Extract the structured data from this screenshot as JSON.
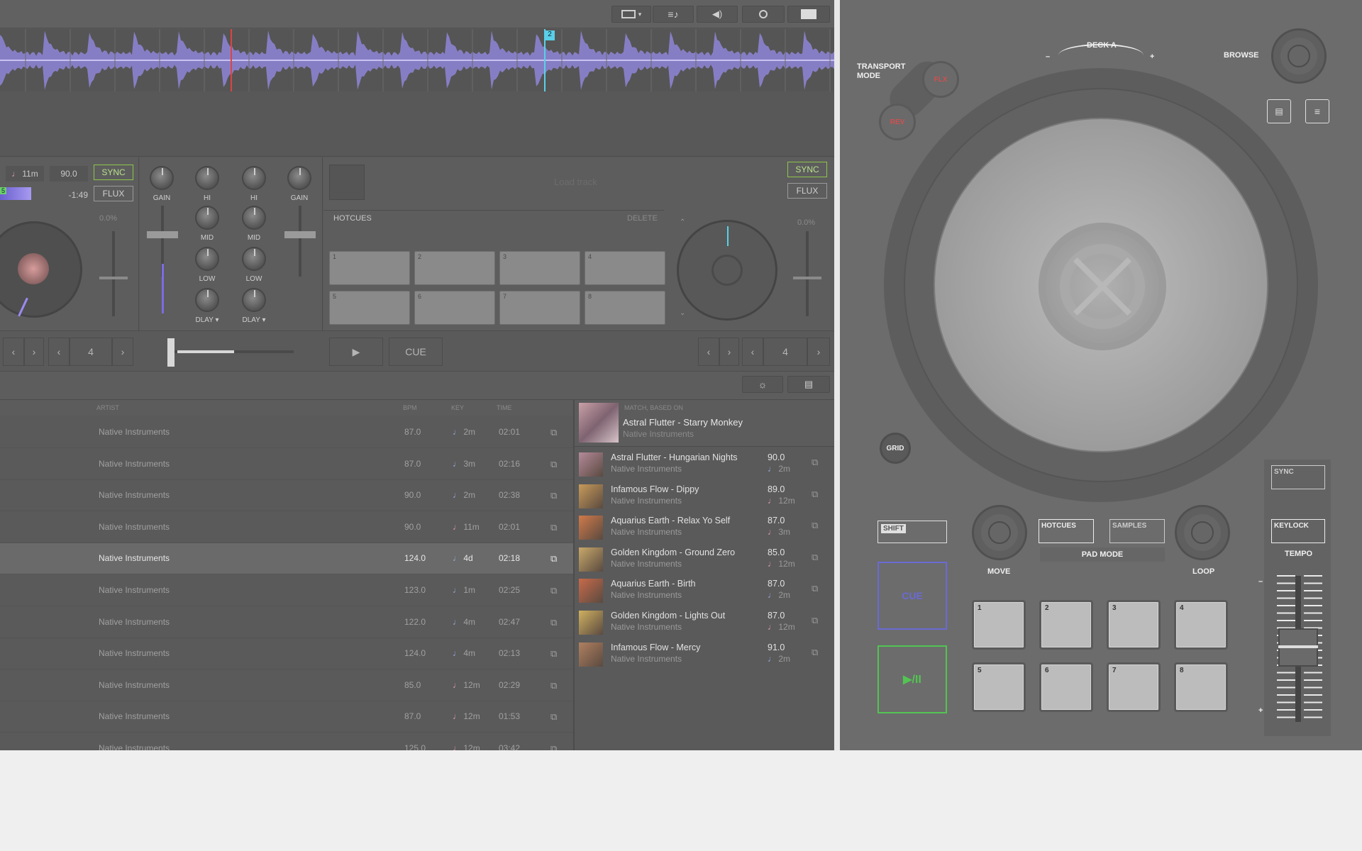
{
  "software": {
    "toolbar": {
      "layout_icon": "layout-icon",
      "list_icon": "playlist-icon",
      "volume_icon": "volume-icon",
      "record_icon": "record-icon",
      "ni_icon": "ni-logo-icon"
    },
    "waveform": {
      "cue_marker": "2"
    },
    "deck_left": {
      "key": "11m",
      "bpm": "90.0",
      "sync": "SYNC",
      "flux": "FLUX",
      "time": "-1:49",
      "pitch": "0.0%",
      "loop_size": "4",
      "cue_num": "5"
    },
    "mixer": {
      "gain_left": "GAIN",
      "hi_left": "HI",
      "mid_left": "MID",
      "low_left": "LOW",
      "fx_left": "DLAY",
      "hi_right": "HI",
      "mid_right": "MID",
      "low_right": "LOW",
      "fx_right": "DLAY",
      "gain_right": "GAIN"
    },
    "deck_right": {
      "load": "Load track",
      "sync": "SYNC",
      "flux": "FLUX",
      "pitch": "0.0%",
      "loop_size": "4",
      "hotcues_title": "HOTCUES",
      "delete": "DELETE",
      "pads": [
        "1",
        "2",
        "3",
        "4",
        "5",
        "6",
        "7",
        "8"
      ],
      "play": "▶",
      "cue": "CUE"
    },
    "browser": {
      "headers": {
        "artist": "ARTIST",
        "bpm": "BPM",
        "key": "KEY",
        "time": "TIME"
      },
      "rows": [
        {
          "artist": "Native Instruments",
          "bpm": "87.0",
          "key": "2m",
          "time": "02:01",
          "kc": "#9aaee6"
        },
        {
          "artist": "Native Instruments",
          "bpm": "87.0",
          "key": "3m",
          "time": "02:16",
          "kc": "#9aaee6"
        },
        {
          "artist": "Native Instruments",
          "bpm": "90.0",
          "key": "2m",
          "time": "02:38",
          "kc": "#9aaee6"
        },
        {
          "artist": "Native Instruments",
          "bpm": "90.0",
          "key": "11m",
          "time": "02:01",
          "kc": "#e6a0b4"
        },
        {
          "artist": "Native Instruments",
          "bpm": "124.0",
          "key": "4d",
          "time": "02:18",
          "kc": "#9aaee6",
          "selected": true
        },
        {
          "artist": "Native Instruments",
          "bpm": "123.0",
          "key": "1m",
          "time": "02:25",
          "kc": "#9aaee6"
        },
        {
          "artist": "Native Instruments",
          "bpm": "122.0",
          "key": "4m",
          "time": "02:47",
          "kc": "#9aaee6"
        },
        {
          "artist": "Native Instruments",
          "bpm": "124.0",
          "key": "4m",
          "time": "02:13",
          "kc": "#9aaee6"
        },
        {
          "artist": "Native Instruments",
          "bpm": "85.0",
          "key": "12m",
          "time": "02:29",
          "kc": "#e6a0b4"
        },
        {
          "artist": "Native Instruments",
          "bpm": "87.0",
          "key": "12m",
          "time": "01:53",
          "kc": "#e6a0b4"
        },
        {
          "artist": "Native Instruments",
          "bpm": "125.0",
          "key": "12m",
          "time": "03:42",
          "kc": "#e6a0b4"
        }
      ],
      "match": {
        "label": "MATCH, BASED ON",
        "base_title": "Astral Flutter - Starry Monkey",
        "base_artist": "Native Instruments",
        "items": [
          {
            "title": "Astral Flutter - Hungarian Nights",
            "artist": "Native Instruments",
            "bpm": "90.0",
            "key": "2m",
            "kc": "#9aaee6"
          },
          {
            "title": "Infamous Flow - Dippy",
            "artist": "Native Instruments",
            "bpm": "89.0",
            "key": "12m",
            "kc": "#e6a0b4"
          },
          {
            "title": "Aquarius Earth - Relax Yo Self",
            "artist": "Native Instruments",
            "bpm": "87.0",
            "key": "3m",
            "kc": "#e6a0b4"
          },
          {
            "title": "Golden Kingdom - Ground Zero",
            "artist": "Native Instruments",
            "bpm": "85.0",
            "key": "12m",
            "kc": "#e6a0b4"
          },
          {
            "title": "Aquarius Earth - Birth",
            "artist": "Native Instruments",
            "bpm": "87.0",
            "key": "2m",
            "kc": "#9aaee6"
          },
          {
            "title": "Golden Kingdom - Lights Out",
            "artist": "Native Instruments",
            "bpm": "87.0",
            "key": "12m",
            "kc": "#e6a0b4"
          },
          {
            "title": "Infamous Flow - Mercy",
            "artist": "Native Instruments",
            "bpm": "91.0",
            "key": "2m",
            "kc": "#9aaee6"
          }
        ]
      }
    }
  },
  "hardware": {
    "transport_mode": "TRANSPORT\nMODE",
    "flx": "FLX",
    "rev": "REV",
    "deck": "DECK A",
    "minus": "–",
    "plus": "+",
    "browse": "BROWSE",
    "grid": "GRID",
    "shift": "SHIFT",
    "cue": "CUE",
    "playpause": "▶/II",
    "move": "MOVE",
    "hotcues": "HOTCUES",
    "samples": "SAMPLES",
    "pad_mode": "PAD MODE",
    "loop": "LOOP",
    "sync": "SYNC",
    "keylock": "KEYLOCK",
    "tempo": "TEMPO",
    "tempo_minus": "–",
    "tempo_plus": "+",
    "pads": [
      "1",
      "2",
      "3",
      "4",
      "5",
      "6",
      "7",
      "8"
    ],
    "colors": {
      "cue": "#6a6ad6",
      "play": "#52c452",
      "flx": "#d05050"
    }
  }
}
